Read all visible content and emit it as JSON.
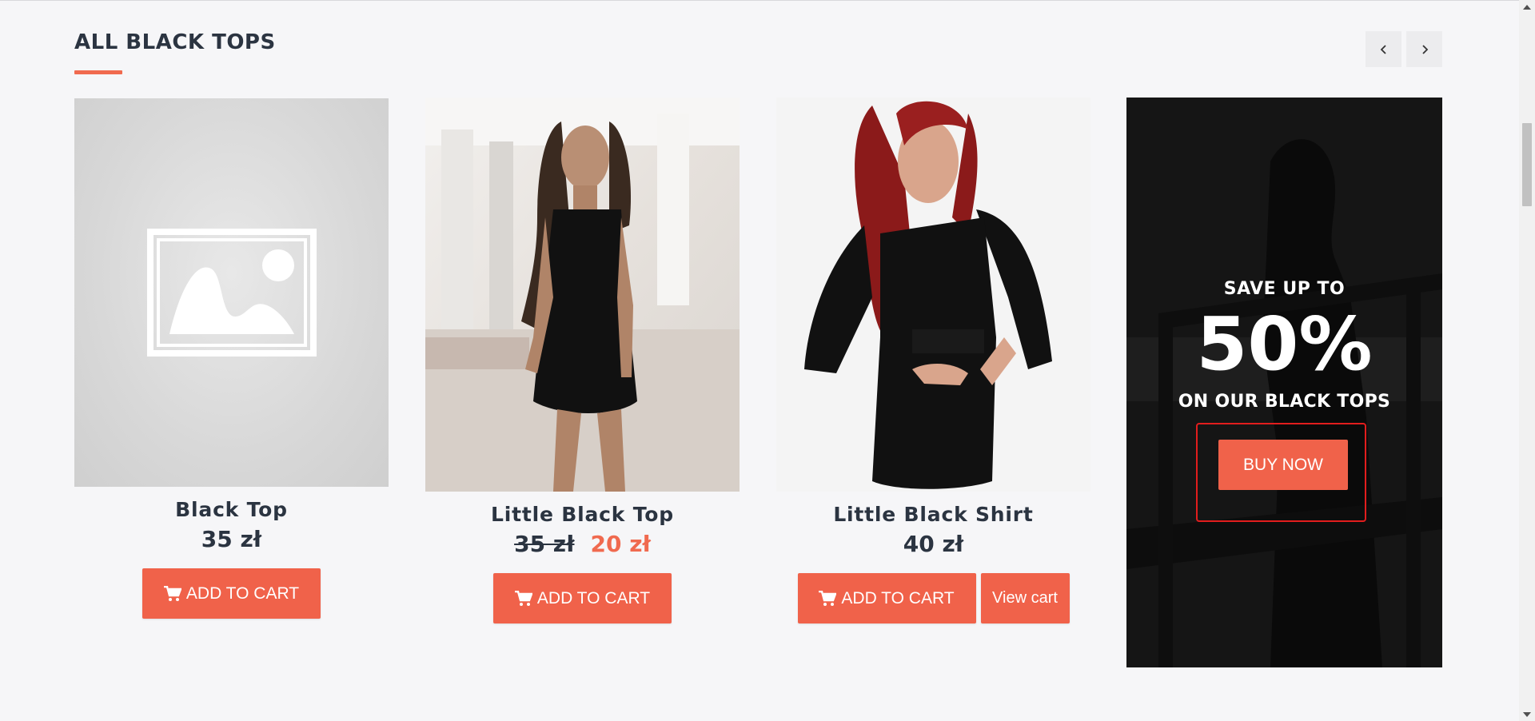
{
  "section": {
    "title": "ALL BLACK TOPS",
    "nav": {
      "prev_icon": "chevron-left-icon",
      "next_icon": "chevron-right-icon"
    }
  },
  "products": [
    {
      "name": "Black Top",
      "price": "35 zł",
      "image": "image-placeholder-icon",
      "add_to_cart": "ADD TO CART"
    },
    {
      "name": "Little Black Top",
      "old_price": "35 zł",
      "sale_price": "20 zł",
      "image": "woman-in-black-dress-photo",
      "add_to_cart": "ADD TO CART"
    },
    {
      "name": "Little Black Shirt",
      "price": "40 zł",
      "image": "red-haired-woman-black-dress-photo",
      "add_to_cart": "ADD TO CART",
      "view_cart": "View cart"
    }
  ],
  "banner": {
    "line1": "SAVE UP TO",
    "big": "50%",
    "line2": "ON OUR BLACK TOPS",
    "button": "BUY NOW"
  },
  "colors": {
    "accent": "#f0624a",
    "text": "#2b3441",
    "background": "#f6f6f8"
  }
}
